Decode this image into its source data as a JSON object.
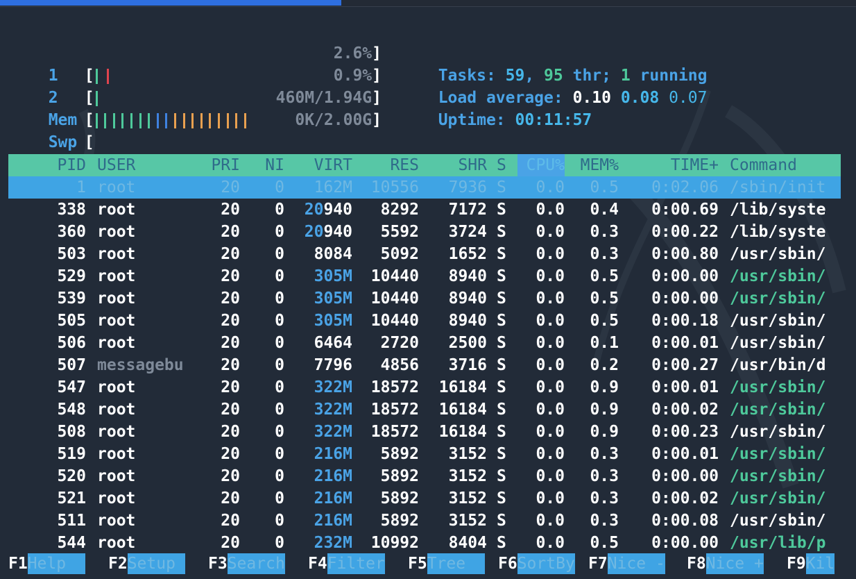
{
  "meters": [
    {
      "label": "1",
      "open": "[",
      "value": "2.6%",
      "close": "]"
    },
    {
      "label": "2",
      "open": "[",
      "value": "0.9%",
      "close": "]"
    },
    {
      "label": "Mem",
      "open": "[",
      "value": "460M/1.94G",
      "close": "]"
    },
    {
      "label": "Swp",
      "open": "[",
      "value": "0K/2.00G",
      "close": "]"
    }
  ],
  "info": {
    "tasks_label": "Tasks: ",
    "tasks_count": "59",
    "thr_sep": ", ",
    "thr_count": "95",
    "thr_label": " thr; ",
    "running_count": "1",
    "running_label": " running",
    "load_label": "Load average: ",
    "load_1": "0.10",
    "load_5": "0.08",
    "load_15": "0.07",
    "uptime_label": "Uptime: ",
    "uptime_value": "00:11:57"
  },
  "columns": [
    "PID",
    "USER",
    "PRI",
    "NI",
    "VIRT",
    "RES",
    "SHR",
    "S",
    "CPU%",
    "MEM%",
    "TIME+",
    "Command"
  ],
  "processes": [
    {
      "pid": "1",
      "user": "root",
      "pri": "20",
      "ni": "0",
      "virt": "162M",
      "res": "10556",
      "shr": "7936",
      "s": "S",
      "cpu": "0.0",
      "mem": "0.5",
      "time": "0:02.06",
      "cmd": "/sbin/init"
    },
    {
      "pid": "338",
      "user": "root",
      "pri": "20",
      "ni": "0",
      "virt": "20940",
      "res": "8292",
      "shr": "7172",
      "s": "S",
      "cpu": "0.0",
      "mem": "0.4",
      "time": "0:00.69",
      "cmd": "/lib/syste"
    },
    {
      "pid": "360",
      "user": "root",
      "pri": "20",
      "ni": "0",
      "virt": "20940",
      "res": "5592",
      "shr": "3724",
      "s": "S",
      "cpu": "0.0",
      "mem": "0.3",
      "time": "0:00.22",
      "cmd": "/lib/syste"
    },
    {
      "pid": "503",
      "user": "root",
      "pri": "20",
      "ni": "0",
      "virt": "8084",
      "res": "5092",
      "shr": "1652",
      "s": "S",
      "cpu": "0.0",
      "mem": "0.3",
      "time": "0:00.80",
      "cmd": "/usr/sbin/"
    },
    {
      "pid": "529",
      "user": "root",
      "pri": "20",
      "ni": "0",
      "virt": "305M",
      "res": "10440",
      "shr": "8940",
      "s": "S",
      "cpu": "0.0",
      "mem": "0.5",
      "time": "0:00.00",
      "cmd": "/usr/sbin/"
    },
    {
      "pid": "539",
      "user": "root",
      "pri": "20",
      "ni": "0",
      "virt": "305M",
      "res": "10440",
      "shr": "8940",
      "s": "S",
      "cpu": "0.0",
      "mem": "0.5",
      "time": "0:00.00",
      "cmd": "/usr/sbin/"
    },
    {
      "pid": "505",
      "user": "root",
      "pri": "20",
      "ni": "0",
      "virt": "305M",
      "res": "10440",
      "shr": "8940",
      "s": "S",
      "cpu": "0.0",
      "mem": "0.5",
      "time": "0:00.18",
      "cmd": "/usr/sbin/"
    },
    {
      "pid": "506",
      "user": "root",
      "pri": "20",
      "ni": "0",
      "virt": "6464",
      "res": "2720",
      "shr": "2500",
      "s": "S",
      "cpu": "0.0",
      "mem": "0.1",
      "time": "0:00.01",
      "cmd": "/usr/sbin/"
    },
    {
      "pid": "507",
      "user": "messagebu",
      "pri": "20",
      "ni": "0",
      "virt": "7796",
      "res": "4856",
      "shr": "3716",
      "s": "S",
      "cpu": "0.0",
      "mem": "0.2",
      "time": "0:00.27",
      "cmd": "/usr/bin/d"
    },
    {
      "pid": "547",
      "user": "root",
      "pri": "20",
      "ni": "0",
      "virt": "322M",
      "res": "18572",
      "shr": "16184",
      "s": "S",
      "cpu": "0.0",
      "mem": "0.9",
      "time": "0:00.01",
      "cmd": "/usr/sbin/"
    },
    {
      "pid": "548",
      "user": "root",
      "pri": "20",
      "ni": "0",
      "virt": "322M",
      "res": "18572",
      "shr": "16184",
      "s": "S",
      "cpu": "0.0",
      "mem": "0.9",
      "time": "0:00.02",
      "cmd": "/usr/sbin/"
    },
    {
      "pid": "508",
      "user": "root",
      "pri": "20",
      "ni": "0",
      "virt": "322M",
      "res": "18572",
      "shr": "16184",
      "s": "S",
      "cpu": "0.0",
      "mem": "0.9",
      "time": "0:00.23",
      "cmd": "/usr/sbin/"
    },
    {
      "pid": "519",
      "user": "root",
      "pri": "20",
      "ni": "0",
      "virt": "216M",
      "res": "5892",
      "shr": "3152",
      "s": "S",
      "cpu": "0.0",
      "mem": "0.3",
      "time": "0:00.01",
      "cmd": "/usr/sbin/"
    },
    {
      "pid": "520",
      "user": "root",
      "pri": "20",
      "ni": "0",
      "virt": "216M",
      "res": "5892",
      "shr": "3152",
      "s": "S",
      "cpu": "0.0",
      "mem": "0.3",
      "time": "0:00.00",
      "cmd": "/usr/sbin/"
    },
    {
      "pid": "521",
      "user": "root",
      "pri": "20",
      "ni": "0",
      "virt": "216M",
      "res": "5892",
      "shr": "3152",
      "s": "S",
      "cpu": "0.0",
      "mem": "0.3",
      "time": "0:00.02",
      "cmd": "/usr/sbin/"
    },
    {
      "pid": "511",
      "user": "root",
      "pri": "20",
      "ni": "0",
      "virt": "216M",
      "res": "5892",
      "shr": "3152",
      "s": "S",
      "cpu": "0.0",
      "mem": "0.3",
      "time": "0:00.08",
      "cmd": "/usr/sbin/"
    },
    {
      "pid": "544",
      "user": "root",
      "pri": "20",
      "ni": "0",
      "virt": "232M",
      "res": "10992",
      "shr": "8404",
      "s": "S",
      "cpu": "0.0",
      "mem": "0.5",
      "time": "0:00.00",
      "cmd": "/usr/lib/p"
    }
  ],
  "footer": [
    {
      "key": "F1",
      "label": "Help  "
    },
    {
      "key": "F2",
      "label": "Setup "
    },
    {
      "key": "F3",
      "label": "Search"
    },
    {
      "key": "F4",
      "label": "Filter"
    },
    {
      "key": "F5",
      "label": "Tree  "
    },
    {
      "key": "F6",
      "label": "SortBy"
    },
    {
      "key": "F7",
      "label": "Nice -"
    },
    {
      "key": "F8",
      "label": "Nice +"
    },
    {
      "key": "F9",
      "label": "Kil"
    }
  ],
  "colors": {
    "background": "#222b38",
    "header_bar": "#57c7a6",
    "selected_row": "#3fa4e4",
    "accent_blue": "#4aa3e6",
    "accent_green": "#4ec99b",
    "cpu_bar_green": "#4ec99b",
    "cpu_bar_red": "#e0444e",
    "mem_bar_blue": "#3f82e0",
    "mem_bar_orange": "#e8a050"
  },
  "meter_levels": {
    "cpu1": 0.026,
    "cpu2": 0.009,
    "mem": 0.23,
    "swap": 0.0
  }
}
